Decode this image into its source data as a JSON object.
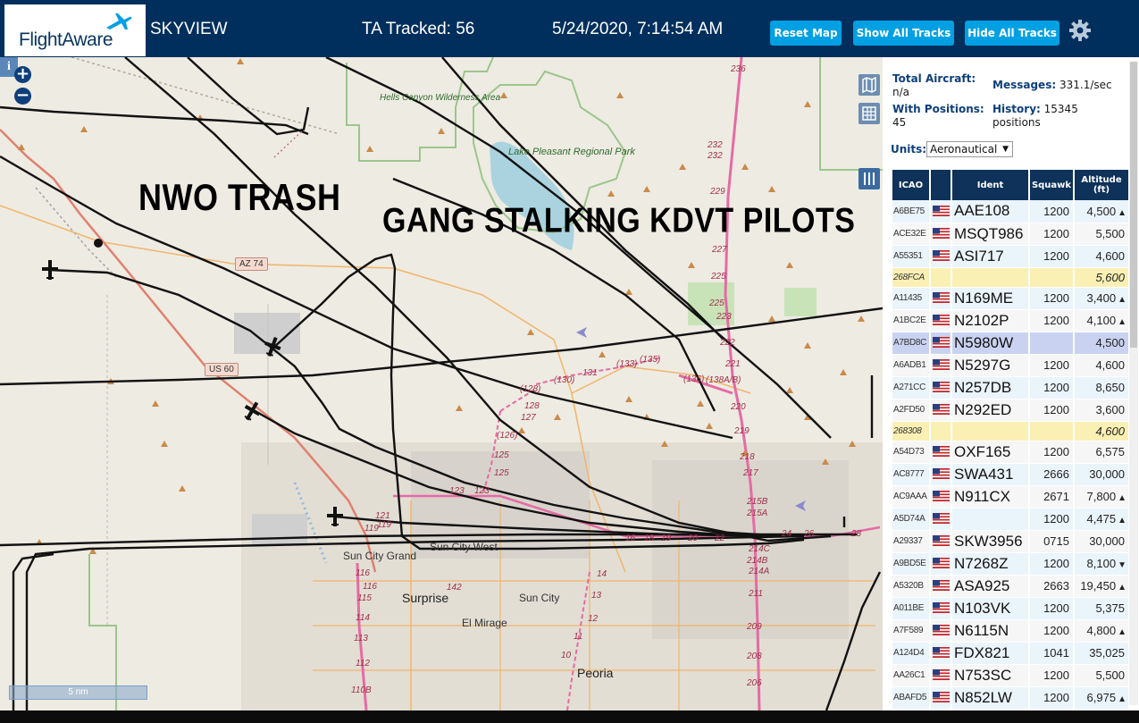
{
  "header": {
    "logo_text": "FlightAware",
    "title": "SKYVIEW",
    "tracked": "TA Tracked: 56",
    "timestamp": "5/24/2020, 7:14:54 AM",
    "buttons": {
      "reset": "Reset Map",
      "show": "Show All Tracks",
      "hide": "Hide All Tracks"
    },
    "settings_icon": "gear-icon",
    "accent_color": "#00a0e2",
    "bar_color": "#002f5d"
  },
  "map": {
    "zoom_in": "+",
    "zoom_out": "−",
    "info": "i",
    "scale": "5 nm",
    "annotations": [
      "NWO TRASH",
      "GANG STALKING KDVT PILOTS"
    ],
    "labels": {
      "hells_canyon": "Hells Canyon Wilderness Area",
      "lake_pleasant": "Lake Pleasant Regional Park",
      "sun_city_west": "Sun City West",
      "sun_city_grand": "Sun City Grand",
      "surprise": "Surprise",
      "sun_city": "Sun City",
      "el_mirage": "El Mirage",
      "peoria": "Peoria"
    },
    "shields": {
      "az74": "AZ 74",
      "us60": "US 60"
    },
    "mileposts": [
      "236",
      "232",
      "232",
      "229",
      "227",
      "225",
      "225",
      "223",
      "222",
      "221",
      "220",
      "219",
      "218",
      "217",
      "215B",
      "215A",
      "214C",
      "214B",
      "214A",
      "211",
      "209",
      "208",
      "206",
      "(128)",
      "(130)",
      "131",
      "(133)",
      "(135)",
      "(136)",
      "(138A/B)",
      "128",
      "127",
      "(126)",
      "125",
      "125",
      "123",
      "123",
      "121",
      "119",
      "119",
      "116",
      "116",
      "115",
      "114",
      "113",
      "112",
      "110B",
      "142",
      "14",
      "13",
      "12",
      "11",
      "10",
      "24",
      "26",
      "28",
      "16",
      "18",
      "19",
      "20",
      "22"
    ]
  },
  "sidebar": {
    "total_aircraft_label": "Total Aircraft:",
    "total_aircraft_value": "n/a",
    "with_positions_label": "With Positions:",
    "with_positions_value": "45",
    "messages_label": "Messages:",
    "messages_value": "331.1/sec",
    "history_label": "History:",
    "history_value": "15345 positions",
    "units_label": "Units:",
    "units_value": "Aeronautical",
    "columns": {
      "icao": "ICAO",
      "ident": "Ident",
      "squawk": "Squawk",
      "altitude": "Altitude (ft)"
    },
    "rows": [
      {
        "icao": "A6BE75",
        "ident": "AAE108",
        "squawk": "1200",
        "alt": "4,500",
        "trend": "▲",
        "flag": "us-flag-icon"
      },
      {
        "icao": "ACE32E",
        "ident": "MSQT986",
        "squawk": "1200",
        "alt": "5,500",
        "trend": "",
        "flag": "us-flag-icon"
      },
      {
        "icao": "A55351",
        "ident": "ASI717",
        "squawk": "1200",
        "alt": "4,600",
        "trend": "",
        "flag": "us-flag-icon"
      },
      {
        "icao": "268FCA",
        "ident": "",
        "squawk": "",
        "alt": "5,600",
        "trend": "",
        "flag": "",
        "nopos": true
      },
      {
        "icao": "A11435",
        "ident": "N169ME",
        "squawk": "1200",
        "alt": "3,400",
        "trend": "▲",
        "flag": "us-flag-icon"
      },
      {
        "icao": "A1BC2E",
        "ident": "N2102P",
        "squawk": "1200",
        "alt": "4,100",
        "trend": "▲",
        "flag": "us-flag-icon"
      },
      {
        "icao": "A7BD8C",
        "ident": "N5980W",
        "squawk": "",
        "alt": "4,500",
        "trend": "",
        "flag": "us-flag-icon",
        "selected": true
      },
      {
        "icao": "A6ADB1",
        "ident": "N5297G",
        "squawk": "1200",
        "alt": "4,600",
        "trend": "",
        "flag": "us-flag-icon"
      },
      {
        "icao": "A271CC",
        "ident": "N257DB",
        "squawk": "1200",
        "alt": "8,650",
        "trend": "",
        "flag": "us-flag-icon"
      },
      {
        "icao": "A2FD50",
        "ident": "N292ED",
        "squawk": "1200",
        "alt": "3,600",
        "trend": "",
        "flag": "us-flag-icon"
      },
      {
        "icao": "268308",
        "ident": "",
        "squawk": "",
        "alt": "4,600",
        "trend": "",
        "flag": "",
        "nopos": true
      },
      {
        "icao": "A54D73",
        "ident": "OXF165",
        "squawk": "1200",
        "alt": "6,575",
        "trend": "",
        "flag": "us-flag-icon"
      },
      {
        "icao": "AC8777",
        "ident": "SWA431",
        "squawk": "2666",
        "alt": "30,000",
        "trend": "",
        "flag": "us-flag-icon"
      },
      {
        "icao": "AC9AAA",
        "ident": "N911CX",
        "squawk": "2671",
        "alt": "7,800",
        "trend": "▲",
        "flag": "us-flag-icon"
      },
      {
        "icao": "A5D74A",
        "ident": "",
        "squawk": "1200",
        "alt": "4,475",
        "trend": "▲",
        "flag": "us-flag-icon"
      },
      {
        "icao": "A29337",
        "ident": "SKW3956",
        "squawk": "0715",
        "alt": "30,000",
        "trend": "",
        "flag": "us-flag-icon"
      },
      {
        "icao": "A9BD5E",
        "ident": "N7268Z",
        "squawk": "1200",
        "alt": "8,100",
        "trend": "▼",
        "flag": "us-flag-icon"
      },
      {
        "icao": "A5320B",
        "ident": "ASA925",
        "squawk": "2663",
        "alt": "19,450",
        "trend": "▲",
        "flag": "us-flag-icon"
      },
      {
        "icao": "A011BE",
        "ident": "N103VK",
        "squawk": "1200",
        "alt": "5,375",
        "trend": "",
        "flag": "us-flag-icon"
      },
      {
        "icao": "A7F589",
        "ident": "N6115N",
        "squawk": "1200",
        "alt": "4,800",
        "trend": "▲",
        "flag": "us-flag-icon"
      },
      {
        "icao": "A124D4",
        "ident": "FDX821",
        "squawk": "1041",
        "alt": "35,025",
        "trend": "",
        "flag": "us-flag-icon"
      },
      {
        "icao": "AA26C1",
        "ident": "N753SC",
        "squawk": "1200",
        "alt": "5,500",
        "trend": "",
        "flag": "us-flag-icon"
      },
      {
        "icao": "ABAFD5",
        "ident": "N852LW",
        "squawk": "1200",
        "alt": "6,975",
        "trend": "▲",
        "flag": "us-flag-icon"
      }
    ]
  }
}
